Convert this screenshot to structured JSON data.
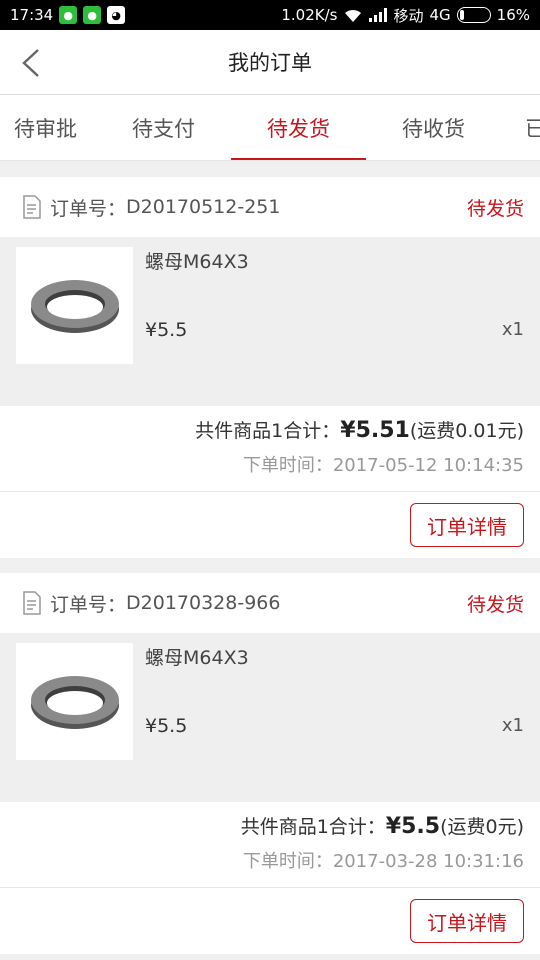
{
  "statusbar": {
    "time": "17:34",
    "speed": "1.02K/s",
    "carrier": "移动",
    "network": "4G",
    "battery": "16%",
    "battery_fraction": 0.16
  },
  "header": {
    "title": "我的订单"
  },
  "tabs": [
    {
      "label": "待审批"
    },
    {
      "label": "待支付"
    },
    {
      "label": "待发货"
    },
    {
      "label": "待收货"
    },
    {
      "label": "已"
    }
  ],
  "active_tab": 2,
  "orders": [
    {
      "order_label": "订单号：",
      "order_no": "D20170512-251",
      "status": "待发货",
      "product_name": "螺母M64X3",
      "product_price": "¥5.5",
      "product_qty": "x1",
      "summary_prefix": "共件商品1合计：",
      "summary_amount": "¥5.51",
      "summary_suffix": "(运费0.01元)",
      "order_time": "下单时间：2017-05-12 10:14:35",
      "detail_button": "订单详情"
    },
    {
      "order_label": "订单号：",
      "order_no": "D20170328-966",
      "status": "待发货",
      "product_name": "螺母M64X3",
      "product_price": "¥5.5",
      "product_qty": "x1",
      "summary_prefix": "共件商品1合计：",
      "summary_amount": "¥5.5",
      "summary_suffix": "(运费0元)",
      "order_time": "下单时间：2017-03-28 10:31:16",
      "detail_button": "订单详情"
    }
  ],
  "colors": {
    "accent": "#c8161d"
  }
}
